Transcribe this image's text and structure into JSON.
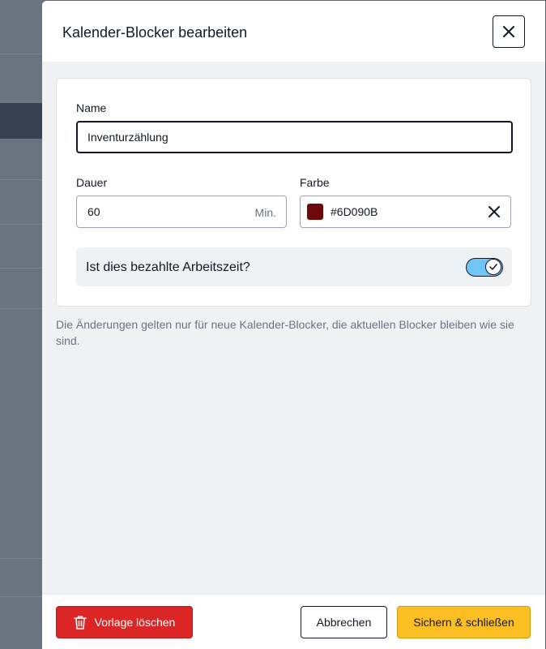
{
  "dialog": {
    "title": "Kalender-Blocker bearbeiten"
  },
  "form": {
    "name_label": "Name",
    "name_value": "Inventurzählung",
    "duration_label": "Dauer",
    "duration_value": "60",
    "duration_unit": "Min.",
    "color_label": "Farbe",
    "color_value": "#6D090B",
    "paid_label": "Ist dies bezahlte Arbeitszeit?",
    "paid_enabled": true
  },
  "hint": "Die Änderungen gelten nur für neue Kalender-Blocker, die aktuellen Blocker bleiben wie sie sind.",
  "footer": {
    "delete_label": "Vorlage löschen",
    "cancel_label": "Abbrechen",
    "save_label": "Sichern & schließen"
  },
  "colors": {
    "swatch": "#6D090B",
    "toggle_on": "#72c4f5",
    "delete": "#dc2626",
    "save": "#fbbf24"
  }
}
